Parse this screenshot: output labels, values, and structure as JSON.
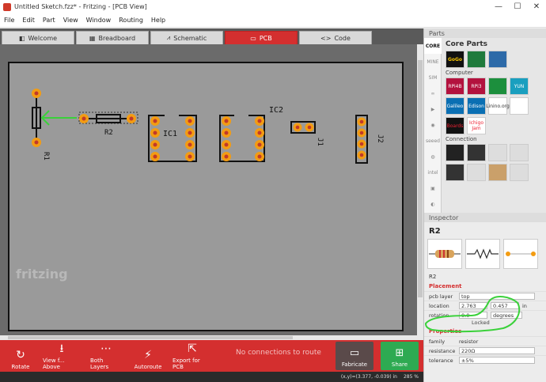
{
  "window": {
    "title": "Untitled Sketch.fzz* - Fritzing - [PCB View]",
    "min": "—",
    "max": "☐",
    "close": "✕"
  },
  "menu": [
    "File",
    "Edit",
    "Part",
    "View",
    "Window",
    "Routing",
    "Help"
  ],
  "tabs": [
    {
      "label": "Welcome",
      "icon": "◧",
      "active": false
    },
    {
      "label": "Breadboard",
      "icon": "▦",
      "active": false
    },
    {
      "label": "Schematic",
      "icon": "⩘",
      "active": false
    },
    {
      "label": "PCB",
      "icon": "▭",
      "active": true
    },
    {
      "label": "Code",
      "icon": "<>",
      "active": false
    }
  ],
  "board": {
    "labels": {
      "r1": "R1",
      "r2": "R2",
      "ic1": "IC1",
      "ic2": "IC2",
      "j1": "J1",
      "j2": "J2"
    },
    "logo": "fritzing"
  },
  "toolbar": {
    "rotate": "Rotate",
    "view_from_above": "View f... Above",
    "both_layers": "Both Layers",
    "autoroute": "Autoroute",
    "export": "Export for PCB",
    "routing_status": "No connections to route",
    "fabricate": "Fabricate",
    "share": "Share"
  },
  "status": {
    "coords": "(x,y)=(3.377, -0.039) in",
    "zoom": "285 %"
  },
  "parts": {
    "title": "Parts",
    "bin_title": "Core Parts",
    "bins": [
      "CORE",
      "MINE",
      "SIM",
      "∞",
      "▶",
      "◉",
      "seeed",
      "◍",
      "intel",
      "▣",
      "◐"
    ],
    "computer_label": "Computer",
    "connection_label": "Connection",
    "tiles_top": [
      "GoGo",
      "",
      ""
    ],
    "tiles_computer": [
      "RPi4B",
      "RPi3",
      "",
      "YUN",
      "Galileo",
      "Edison",
      "Linino.org",
      "",
      "Boards",
      "Ichigo Jam"
    ],
    "tiles_connection": [
      "",
      "",
      "",
      "",
      "",
      "",
      "",
      "",
      "",
      "",
      "",
      ""
    ]
  },
  "inspector": {
    "title": "Inspector",
    "name": "R2",
    "sub_label": "R2",
    "placement_label": "Placement",
    "pcb_layer_label": "pcb layer",
    "pcb_layer_value": "top",
    "location_label": "location",
    "location_x": "2.763",
    "location_y": "0.457",
    "location_unit": "in",
    "rotation_label": "rotation",
    "rotation_value": "0.0",
    "rotation_unit": "degrees",
    "locked_label": "Locked",
    "properties_label": "Properties",
    "family_label": "family",
    "family_value": "resistor",
    "resistance_label": "resistance",
    "resistance_value": "220Ω",
    "tolerance_label": "tolerance",
    "tolerance_value": "±5%"
  },
  "colors": {
    "accent": "#d42f2f",
    "share": "#2eaa52",
    "annotation": "#3ad13a",
    "pad": "#f39c12"
  }
}
